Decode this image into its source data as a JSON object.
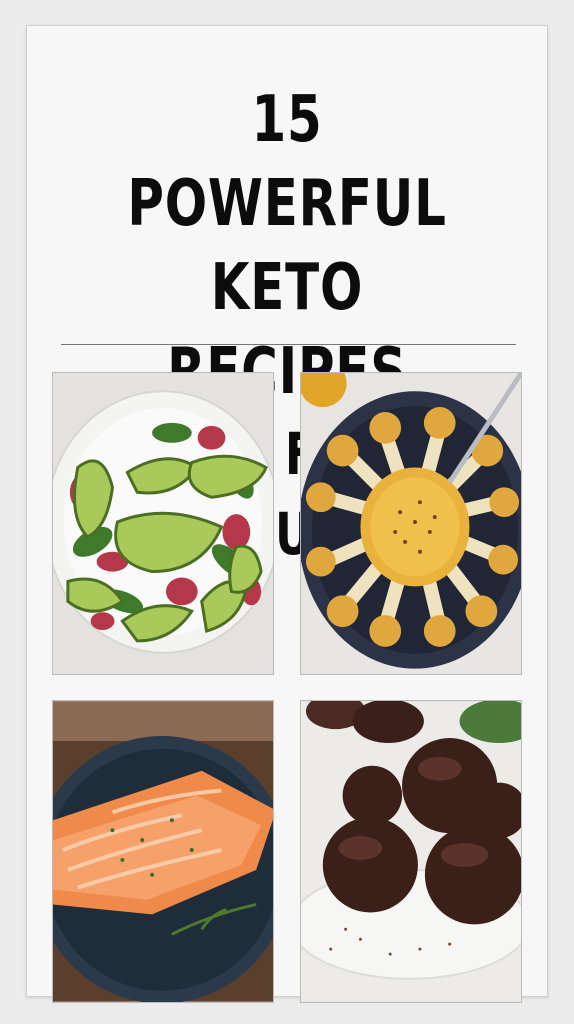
{
  "pin": {
    "title_line1": "15 POWERFUL",
    "title_line2": "KETO RECIPES",
    "title_line3": "FOR FAST RESULTS"
  },
  "photos": [
    {
      "icon": "avocado-salad-photo"
    },
    {
      "icon": "roasted-cauliflower-photo"
    },
    {
      "icon": "salmon-fillet-photo"
    },
    {
      "icon": "chocolate-fat-bombs-photo"
    }
  ],
  "colors": {
    "title": "#0c0c0c",
    "card": "#f7f7f7",
    "background": "#ececec"
  }
}
